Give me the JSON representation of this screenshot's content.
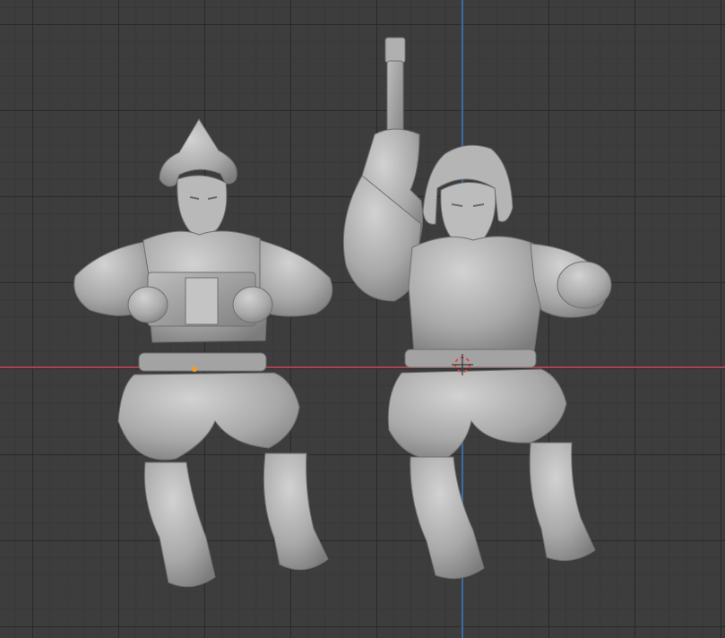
{
  "viewport": {
    "background": "#3d3d3d",
    "grid_minor": "#373737",
    "grid_major": "#2b2b2b",
    "x_axis_color": "#a8464f",
    "y_axis_color": "#3c6aa3"
  },
  "scene": {
    "objects": [
      {
        "name": "pilot-figure-left",
        "description_icon": "figure-driving-icon"
      },
      {
        "name": "pilot-figure-right",
        "description_icon": "figure-blaster-icon"
      }
    ],
    "cursor_icon": "3d-cursor-icon",
    "origin_icon": "object-origin-icon"
  }
}
